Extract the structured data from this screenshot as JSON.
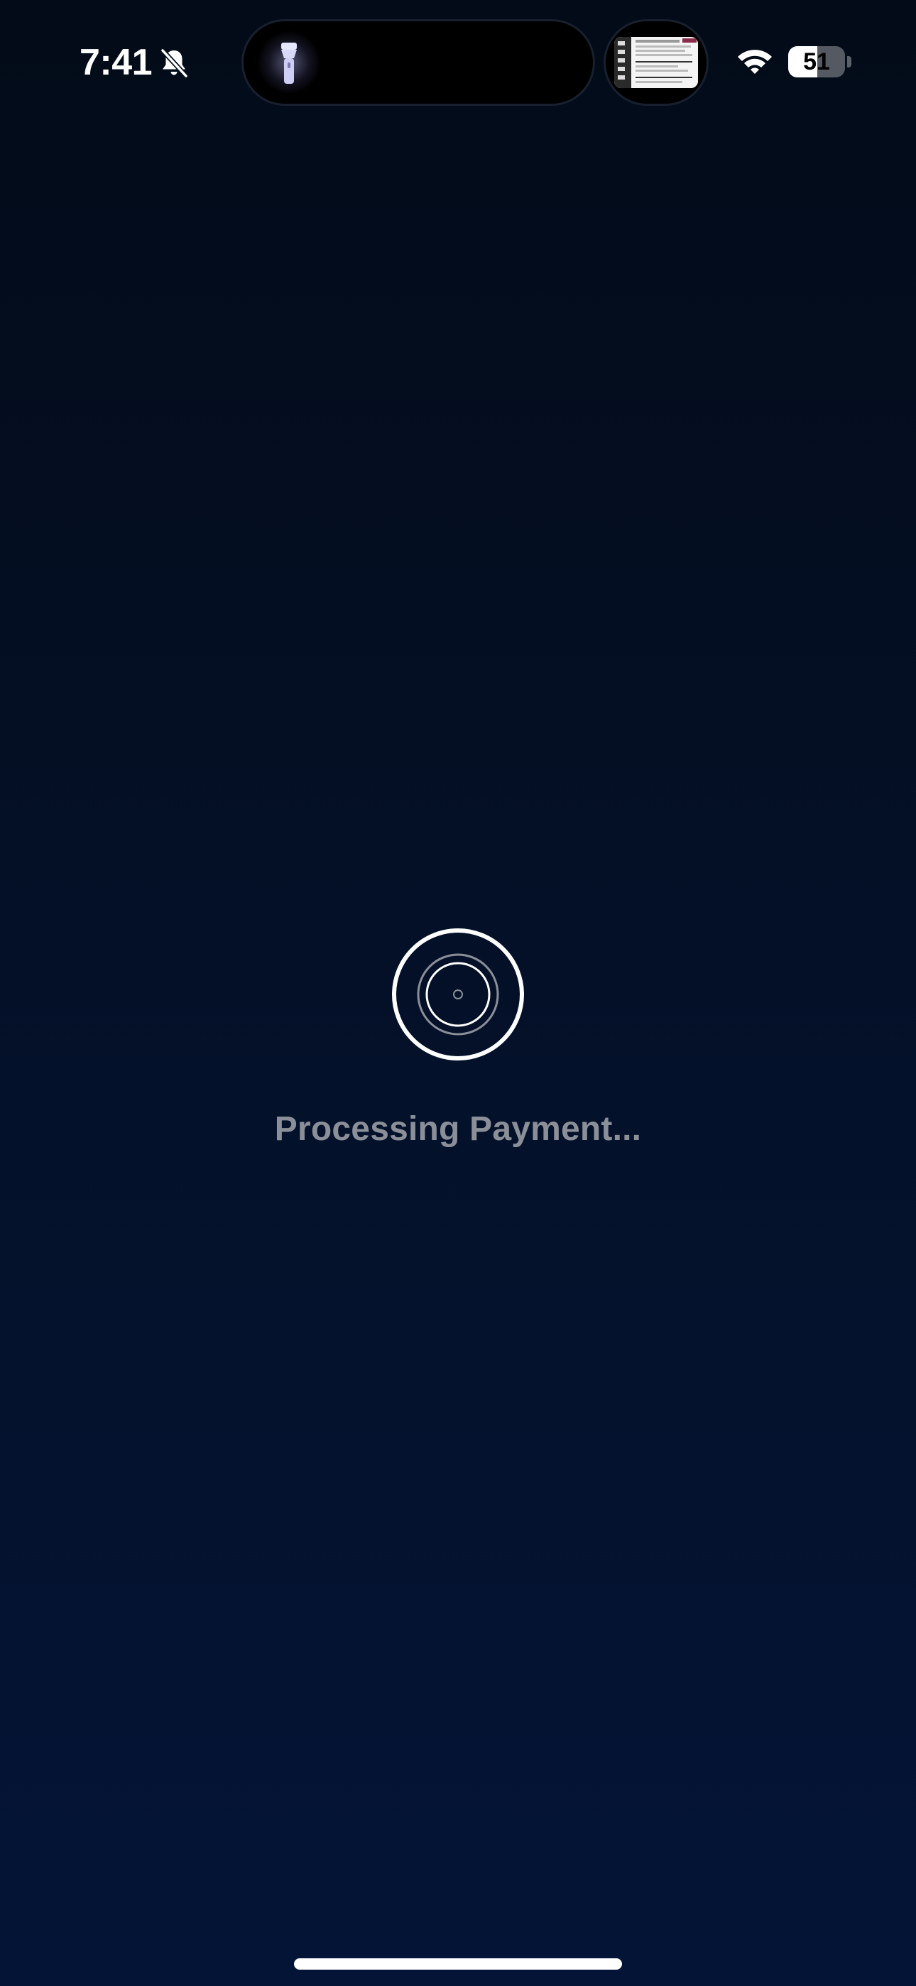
{
  "status_bar": {
    "time": "7:41",
    "silent_icon": "bell-slash-icon",
    "live_activity_icon": "flashlight-icon",
    "wifi_icon": "wifi-icon",
    "battery_level": "51",
    "battery_fraction": 0.51
  },
  "main": {
    "loader_icon": "spinner-icon",
    "status_text": "Processing Payment..."
  },
  "colors": {
    "background_top": "#030b18",
    "background_bottom": "#041436",
    "status_text": "#8b8f98",
    "foreground": "#ffffff"
  }
}
